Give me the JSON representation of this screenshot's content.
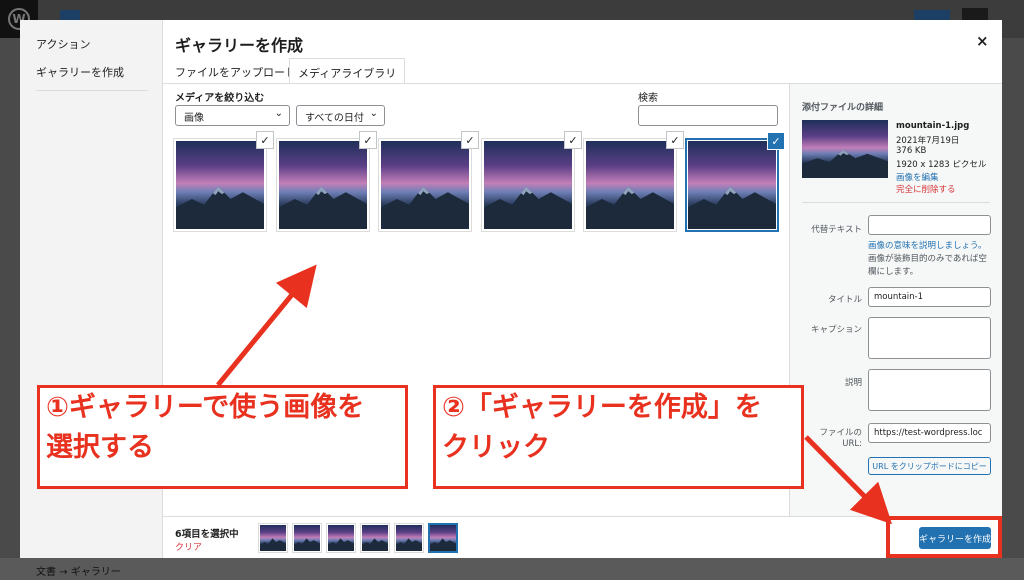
{
  "modal": {
    "title": "ギャラリーを作成",
    "close": "×",
    "menu": {
      "header": "アクション",
      "item": "ギャラリーを作成"
    },
    "tabs": [
      "ファイルをアップロード",
      "メディアライブラリ"
    ],
    "filter_label": "メディアを絞り込む",
    "filter_type": "画像",
    "filter_date": "すべての日付",
    "search_label": "検索"
  },
  "details": {
    "heading": "添付ファイルの詳細",
    "filename": "mountain-1.jpg",
    "date": "2021年7月19日",
    "size": "376 KB",
    "dimensions": "1920 x 1283 ピクセル",
    "edit_link": "画像を編集",
    "delete_link": "完全に削除する",
    "alt_label": "代替テキスト",
    "alt_help_link": "画像の意味を説明しましょう。",
    "alt_help_text1": "画像が装飾目的のみであれば空",
    "alt_help_text2": "欄にします。",
    "title_label": "タイトル",
    "title_value": "mountain-1",
    "caption_label": "キャプション",
    "description_label": "説明",
    "url_label_1": "ファイルの",
    "url_label_2": "URL:",
    "url_value": "https://test-wordpress.loc",
    "copy_button": "URL をクリップボードにコピー"
  },
  "toolbar": {
    "selected_count": "6項目を選択中",
    "clear": "クリア",
    "create_button": "ギャラリーを作成"
  },
  "annotations": {
    "step1_line1": "①ギャラリーで使う画像を",
    "step1_line2": "選択する",
    "step2_line1": "②「ギャラリーを作成」を",
    "step2_line2": "クリック"
  },
  "footer": {
    "breadcrumb": "文書 → ギャラリー"
  },
  "images": {
    "count": 6,
    "selected": 6
  },
  "colors": {
    "accent": "#2271b1",
    "annotation": "#e8311f",
    "danger": "#d63638"
  }
}
